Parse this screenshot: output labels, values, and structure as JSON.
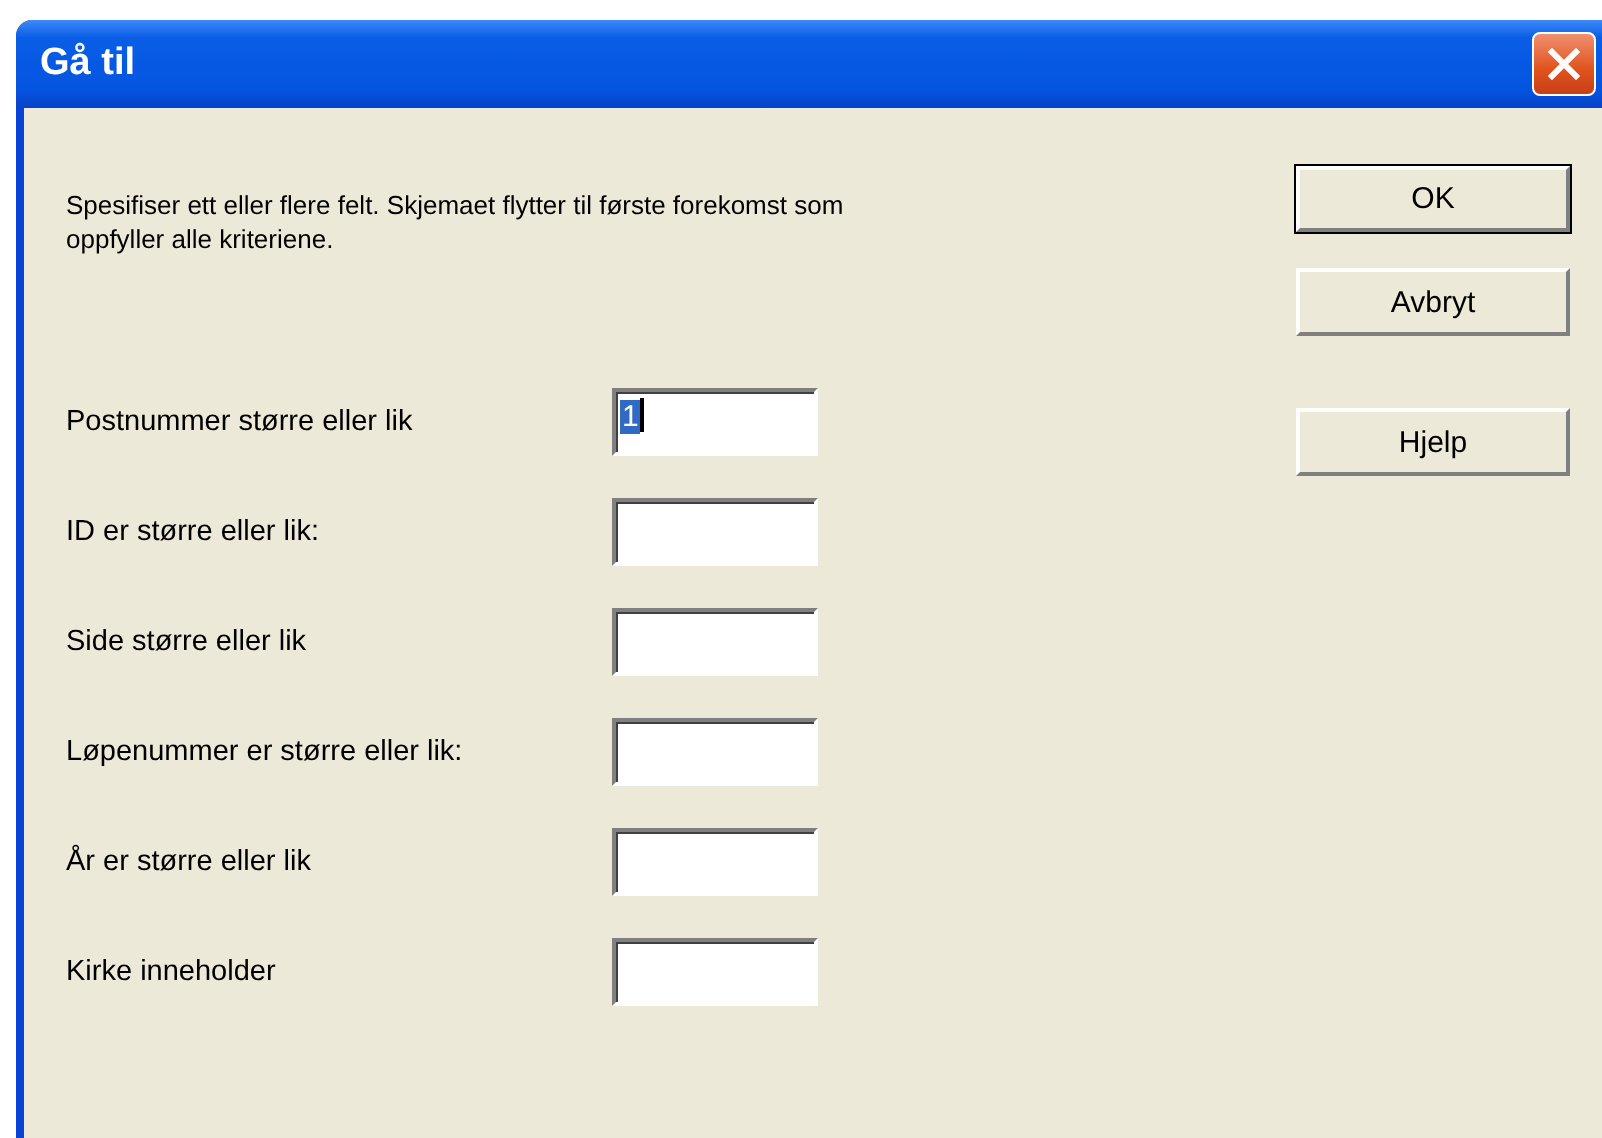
{
  "window": {
    "title": "Gå til"
  },
  "instructions": "Spesifiser ett eller flere felt. Skjemaet flytter til første forekomst som oppfyller alle kriteriene.",
  "buttons": [
    {
      "label": "OK",
      "default": true
    },
    {
      "label": "Avbryt",
      "default": false
    },
    {
      "label": "Hjelp",
      "default": false
    }
  ],
  "fields": [
    {
      "label": "Postnummer større eller lik",
      "value": "1",
      "focused": true
    },
    {
      "label": "ID er større eller lik:",
      "focused": false
    },
    {
      "label": "Side større eller lik",
      "focused": false
    },
    {
      "label": "Løpenummer er større eller lik:",
      "focused": false
    },
    {
      "label": "År er større eller lik",
      "focused": false
    },
    {
      "label": "Kirke inneholder",
      "focused": false
    }
  ]
}
